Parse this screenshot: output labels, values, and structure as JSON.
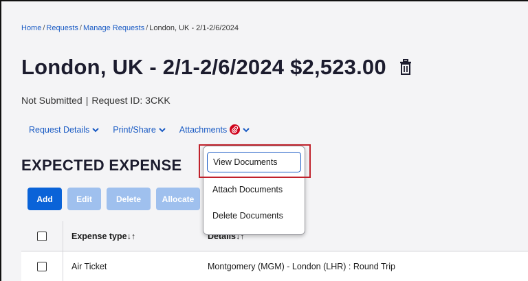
{
  "breadcrumb": {
    "home": "Home",
    "requests": "Requests",
    "manage": "Manage Requests",
    "current": "London, UK - 2/1-2/6/2024",
    "separator": "/"
  },
  "header": {
    "title": "London, UK - 2/1-2/6/2024 $2,523.00",
    "status": "Not Submitted",
    "pipe": "|",
    "request_id": "Request ID: 3CKK"
  },
  "subnav": {
    "request_details": "Request Details",
    "print_share": "Print/Share",
    "attachments": "Attachments"
  },
  "section": {
    "title": "EXPECTED EXPENSE"
  },
  "toolbar": {
    "add": "Add",
    "edit": "Edit",
    "delete": "Delete",
    "allocate": "Allocate"
  },
  "table": {
    "columns": [
      "Expense type↓↑",
      "Details↓↑"
    ],
    "rows": [
      {
        "expense_type": "Air Ticket",
        "details": "Montgomery (MGM) - London (LHR) : Round Trip"
      }
    ]
  },
  "dropdown": {
    "items": [
      "View Documents",
      "Attach Documents",
      "Delete Documents"
    ]
  },
  "colors": {
    "link": "#1a5bc4",
    "primary_button": "#0a63d8",
    "disabled_button": "#9fc0ee",
    "badge": "#d0021b",
    "highlight_box": "#c0212b"
  }
}
